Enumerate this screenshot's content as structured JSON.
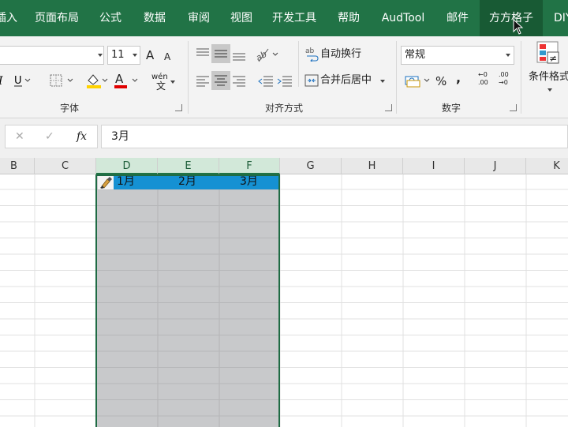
{
  "ribbon_tabs": [
    "插入",
    "页面布局",
    "公式",
    "数据",
    "审阅",
    "视图",
    "开发工具",
    "帮助",
    "AudTool",
    "邮件",
    "方方格子",
    "DIY"
  ],
  "active_tab_index": 10,
  "font_group": {
    "label": "字体",
    "font_name": "",
    "font_size": "11",
    "grow_font": "A",
    "shrink_font": "A",
    "phonetic": "wén",
    "colors": {
      "fill": "#ffd200",
      "font": "#e00000"
    }
  },
  "align_group": {
    "label": "对齐方式",
    "wrap_text": "自动换行",
    "merge_center": "合并后居中"
  },
  "number_group": {
    "label": "数字",
    "format": "常规",
    "percent": "%",
    "comma": ",",
    "inc_decimal": "←0 .00",
    "dec_decimal": ".00 →0"
  },
  "styles_group": {
    "conditional_format": "条件格式"
  },
  "formula_bar": {
    "cancel": "✕",
    "enter": "✓",
    "fx": "fx",
    "value": "3月"
  },
  "columns": [
    "B",
    "C",
    "D",
    "E",
    "F",
    "G",
    "H",
    "I",
    "J",
    "K"
  ],
  "selected_columns": [
    "D",
    "E",
    "F"
  ],
  "header_cells": [
    "1月",
    "2月",
    "3月"
  ],
  "colors": {
    "ribbon": "#217346",
    "active_tab": "#185a34",
    "selection": "#c8c9cb",
    "header_row": "#1591d3",
    "selection_border": "#1f6b44"
  }
}
